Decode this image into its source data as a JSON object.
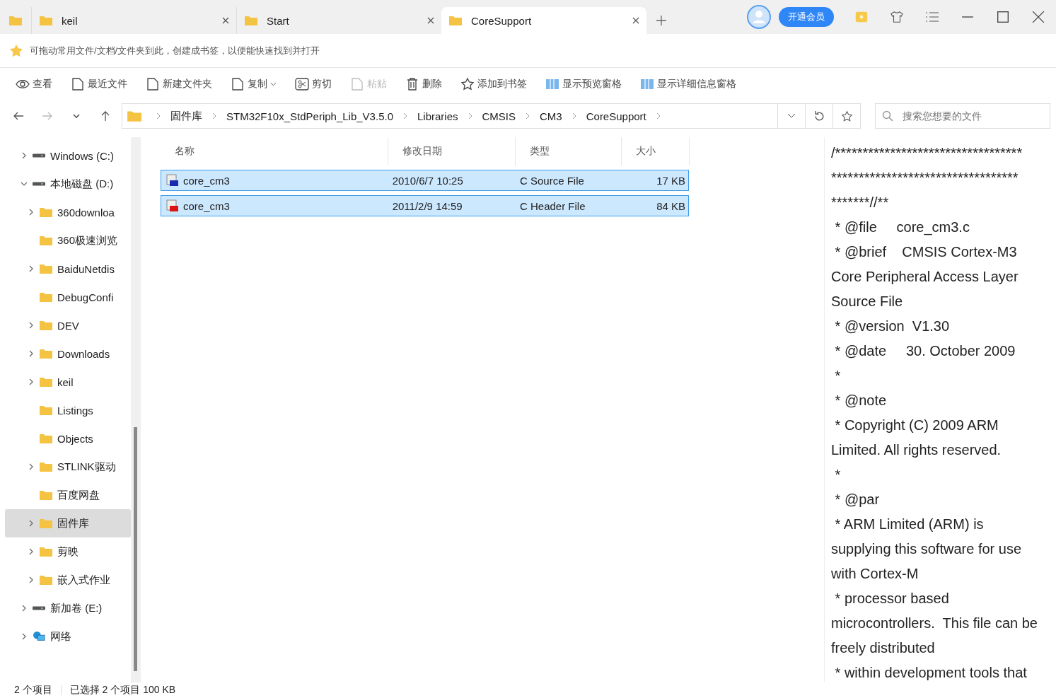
{
  "tabs": [
    {
      "label": "keil",
      "selected": false
    },
    {
      "label": "Start",
      "selected": false
    },
    {
      "label": "CoreSupport",
      "selected": true
    }
  ],
  "vip_button": "开通会员",
  "bookmark_hint": "可拖动常用文件/文档/文件夹到此，创建成书签，以便能快速找到并打开",
  "toolbar": [
    {
      "label": "查看",
      "disabled": false
    },
    {
      "label": "最近文件",
      "disabled": false
    },
    {
      "label": "新建文件夹",
      "disabled": false
    },
    {
      "label": "复制",
      "disabled": false,
      "dropdown": true
    },
    {
      "label": "剪切",
      "disabled": false
    },
    {
      "label": "粘贴",
      "disabled": true
    },
    {
      "label": "删除",
      "disabled": false
    },
    {
      "label": "添加到书签",
      "disabled": false
    },
    {
      "label": "显示预览窗格",
      "disabled": false
    },
    {
      "label": "显示详细信息窗格",
      "disabled": false
    }
  ],
  "breadcrumb": [
    "固件库",
    "STM32F10x_StdPeriph_Lib_V3.5.0",
    "Libraries",
    "CMSIS",
    "CM3",
    "CoreSupport"
  ],
  "search": {
    "placeholder": "搜索您想要的文件"
  },
  "sidebar": {
    "items": [
      {
        "label": "Windows (C:)",
        "kind": "drive",
        "expanded": false,
        "selected": false
      },
      {
        "label": "本地磁盘 (D:)",
        "kind": "drive",
        "expanded": true,
        "selected": false,
        "children": [
          {
            "label": "360downloa",
            "kind": "folder",
            "expanded": false,
            "expandable": true,
            "selected": false
          },
          {
            "label": "360极速浏览",
            "kind": "folder",
            "expandable": false,
            "selected": false
          },
          {
            "label": "BaiduNetdis",
            "kind": "folder",
            "expanded": false,
            "expandable": true,
            "selected": false
          },
          {
            "label": "DebugConfi",
            "kind": "folder",
            "expandable": false,
            "selected": false
          },
          {
            "label": "DEV",
            "kind": "folder",
            "expanded": false,
            "expandable": true,
            "selected": false
          },
          {
            "label": "Downloads",
            "kind": "folder",
            "expanded": false,
            "expandable": true,
            "selected": false
          },
          {
            "label": "keil",
            "kind": "folder",
            "expanded": false,
            "expandable": true,
            "selected": false
          },
          {
            "label": "Listings",
            "kind": "folder",
            "expandable": false,
            "selected": false
          },
          {
            "label": "Objects",
            "kind": "folder",
            "expandable": false,
            "selected": false
          },
          {
            "label": "STLINK驱动",
            "kind": "folder",
            "expanded": false,
            "expandable": true,
            "selected": false
          },
          {
            "label": "百度网盘",
            "kind": "folder",
            "expandable": false,
            "selected": false
          },
          {
            "label": "固件库",
            "kind": "folder",
            "expanded": false,
            "expandable": true,
            "selected": true
          },
          {
            "label": "剪映",
            "kind": "folder",
            "expanded": false,
            "expandable": true,
            "selected": false
          },
          {
            "label": "嵌入式作业",
            "kind": "folder",
            "expanded": false,
            "expandable": true,
            "selected": false
          }
        ]
      },
      {
        "label": "新加卷 (E:)",
        "kind": "drive",
        "expanded": false,
        "selected": false
      },
      {
        "label": "网络",
        "kind": "network",
        "expanded": false,
        "selected": false
      }
    ]
  },
  "table": {
    "columns": [
      "名称",
      "修改日期",
      "类型",
      "大小"
    ],
    "rows": [
      {
        "name": "core_cm3",
        "kind": "c",
        "modified": "2010/6/7 10:25",
        "type": "C Source File",
        "size": "17 KB",
        "selected": true
      },
      {
        "name": "core_cm3",
        "kind": "h",
        "modified": "2011/2/9 14:59",
        "type": "C Header File",
        "size": "84 KB",
        "selected": true
      }
    ]
  },
  "preview": {
    "lines": [
      "/**********************************",
      "**********************************",
      "*******//**",
      " * @file     core_cm3.c",
      " * @brief    CMSIS Cortex-M3",
      "Core Peripheral Access Layer",
      "Source File",
      " * @version  V1.30",
      " * @date     30. October 2009",
      " *",
      " * @note",
      " * Copyright (C) 2009 ARM",
      "Limited. All rights reserved.",
      " *",
      " * @par",
      " * ARM Limited (ARM) is",
      "supplying this software for use",
      "with Cortex-M",
      " * processor based",
      "microcontrollers.  This file can be",
      "freely distributed",
      " * within development tools that"
    ]
  },
  "status_bar": {
    "item_count": "2 个项目",
    "selection": "已选择 2 个项目  100 KB"
  }
}
